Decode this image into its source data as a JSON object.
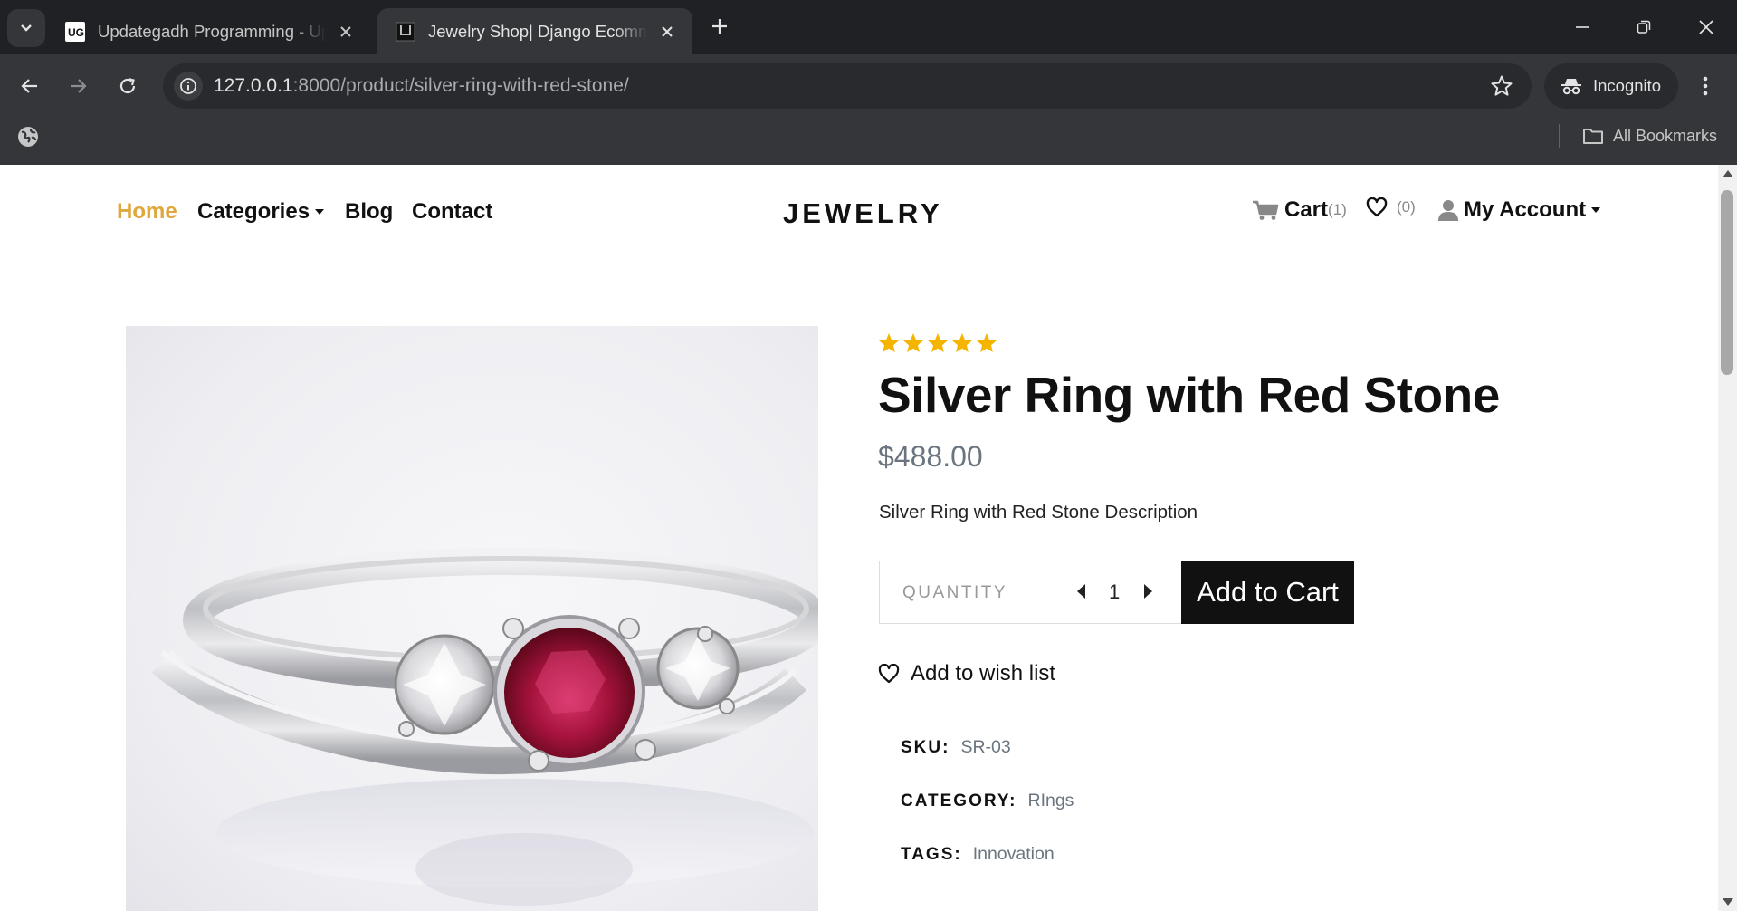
{
  "browser": {
    "tabs": [
      {
        "title": "Updategadh Programming - Up",
        "active": false,
        "favicon": "ug-logo-icon"
      },
      {
        "title": "Jewelry Shop| Django Ecommer",
        "active": true,
        "favicon": "shop-bag-icon"
      }
    ],
    "url_host": "127.0.0.1",
    "url_rest": ":8000/product/silver-ring-with-red-stone/",
    "incognito_label": "Incognito",
    "bookmarks_label": "All Bookmarks"
  },
  "header": {
    "nav": {
      "home": "Home",
      "categories": "Categories",
      "blog": "Blog",
      "contact": "Contact"
    },
    "logo": "JEWELRY",
    "cart_label": "Cart",
    "cart_count": "(1)",
    "wishlist_count": "(0)",
    "account_label": "My Account"
  },
  "product": {
    "rating": 5,
    "rating_max": 5,
    "title": "Silver Ring with Red Stone",
    "price": "$488.00",
    "description": "Silver Ring with Red Stone Description",
    "quantity_label": "QUANTITY",
    "quantity": "1",
    "add_to_cart": "Add to Cart",
    "wishlist_label": "Add to wish list",
    "meta": {
      "sku_label": "SKU:",
      "sku": "SR-03",
      "category_label": "CATEGORY:",
      "category": "RIngs",
      "tags_label": "TAGS:",
      "tags": "Innovation"
    }
  },
  "colors": {
    "accent_home": "#e0a83c",
    "star": "#f5b400",
    "price": "#6b7580",
    "button_bg": "#111111"
  }
}
